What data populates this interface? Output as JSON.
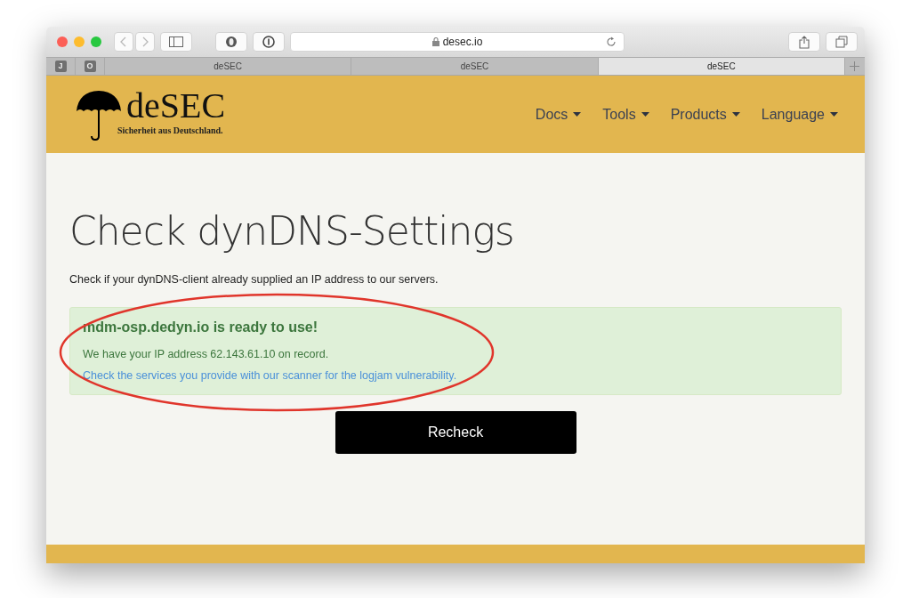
{
  "browser": {
    "address": "desec.io",
    "pinned_tabs": [
      "J",
      "O"
    ],
    "tabs": [
      {
        "label": "deSEC",
        "selected": false
      },
      {
        "label": "deSEC",
        "selected": false
      },
      {
        "label": "deSEC",
        "selected": true
      }
    ]
  },
  "header": {
    "logo_title": "deSEC",
    "logo_tagline": "Sicherheit aus Deutschland.",
    "nav": [
      "Docs",
      "Tools",
      "Products",
      "Language"
    ]
  },
  "page": {
    "title": "Check dynDNS-Settings",
    "intro": "Check if your dynDNS-client already supplied an IP address to our servers.",
    "alert": {
      "heading": "mdm-osp.dedyn.io is ready to use!",
      "message": "We have your IP address 62.143.61.10 on record.",
      "link": "Check the services you provide with our scanner for the logjam vulnerability."
    },
    "button": "Recheck"
  }
}
